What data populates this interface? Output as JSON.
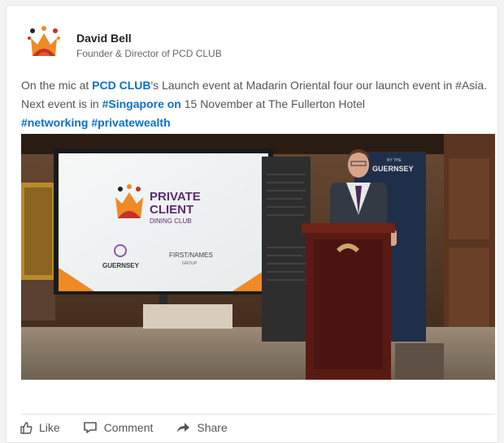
{
  "author": {
    "name": "David Bell",
    "title": "Founder & Director of PCD CLUB"
  },
  "post": {
    "seg1": "On the mic at ",
    "link_pcd": "PCD CLUB",
    "seg2": "'s Launch event at Madarin Oriental four our launch event in #Asia. Next event is in ",
    "link_singapore": "#Singapore on",
    "seg3": " 15 November at The Fullerton Hotel",
    "tag_networking": "#networking",
    "tag_wealth": "#privatewealth"
  },
  "photo": {
    "screen_title_1": "PRIVATE",
    "screen_title_2": "CLIENT",
    "screen_subtitle": "DINING CLUB",
    "screen_logo_left": "GUERNSEY",
    "screen_logo_right": "FIRST/NAMES",
    "screen_logo_right_sub": "GROUP",
    "banner_text": "GUERNSEY",
    "banner_small": "BY THE"
  },
  "actions": {
    "like": "Like",
    "comment": "Comment",
    "share": "Share"
  },
  "colors": {
    "link": "#0a6fcf",
    "logo_red": "#c8302a",
    "logo_orange": "#f08a24",
    "screen_purple": "#5a2d6e"
  }
}
